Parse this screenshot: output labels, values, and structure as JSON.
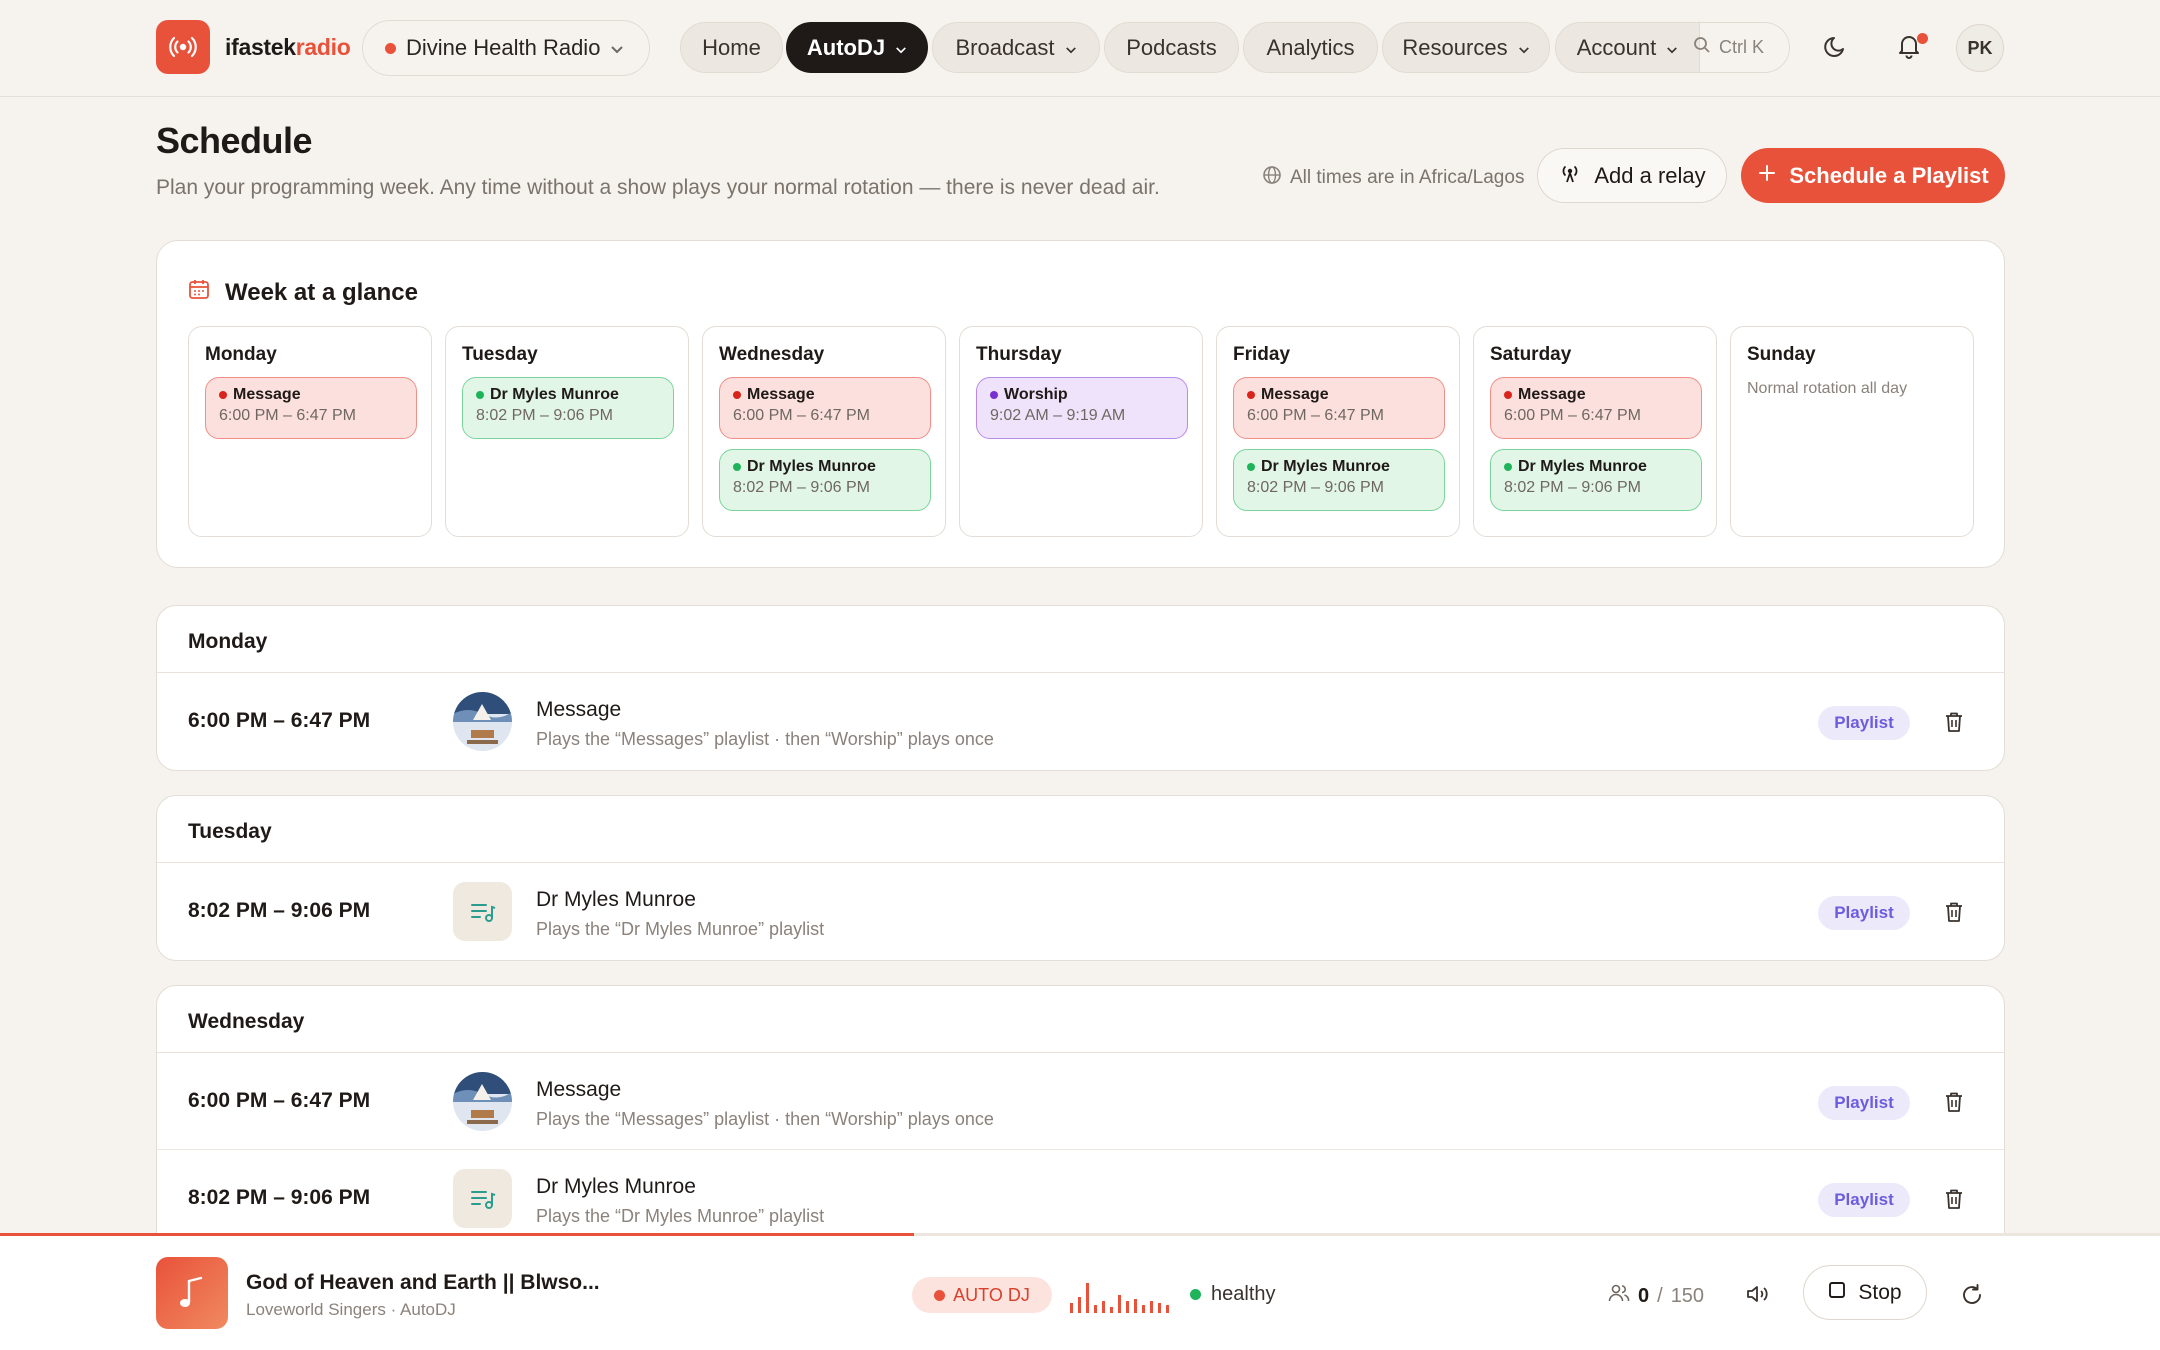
{
  "brand": {
    "name_plain": "ifastek",
    "name_accent": "radio",
    "accent": "#e9523a"
  },
  "station": {
    "name": "Divine Health Radio"
  },
  "nav": {
    "items": [
      {
        "label": "Home"
      },
      {
        "label": "AutoDJ",
        "active": true
      },
      {
        "label": "Broadcast"
      },
      {
        "label": "Podcasts"
      },
      {
        "label": "Analytics"
      },
      {
        "label": "Resources"
      },
      {
        "label": "Account"
      }
    ],
    "search_shortcut": "Ctrl K",
    "user_initials": "PK"
  },
  "header": {
    "title": "Schedule",
    "subtitle": "Plan your programming week. Any time without a show plays your normal rotation — there is never dead air.",
    "timezone": "All times are in Africa/Lagos",
    "add_relay": "Add a relay",
    "schedule_playlist": "Schedule a Playlist"
  },
  "week": {
    "title": "Week at a glance",
    "days": [
      {
        "name": "Monday",
        "shows": [
          {
            "title": "Message",
            "time": "6:00 PM – 6:47 PM",
            "color": "red"
          }
        ]
      },
      {
        "name": "Tuesday",
        "shows": [
          {
            "title": "Dr Myles Munroe",
            "time": "8:02 PM – 9:06 PM",
            "color": "green"
          }
        ]
      },
      {
        "name": "Wednesday",
        "shows": [
          {
            "title": "Message",
            "time": "6:00 PM – 6:47 PM",
            "color": "red"
          },
          {
            "title": "Dr Myles Munroe",
            "time": "8:02 PM – 9:06 PM",
            "color": "green"
          }
        ]
      },
      {
        "name": "Thursday",
        "shows": [
          {
            "title": "Worship",
            "time": "9:02 AM – 9:19 AM",
            "color": "purple"
          }
        ]
      },
      {
        "name": "Friday",
        "shows": [
          {
            "title": "Message",
            "time": "6:00 PM – 6:47 PM",
            "color": "red"
          },
          {
            "title": "Dr Myles Munroe",
            "time": "8:02 PM – 9:06 PM",
            "color": "green"
          }
        ]
      },
      {
        "name": "Saturday",
        "shows": [
          {
            "title": "Message",
            "time": "6:00 PM – 6:47 PM",
            "color": "red"
          },
          {
            "title": "Dr Myles Munroe",
            "time": "8:02 PM – 9:06 PM",
            "color": "green"
          }
        ]
      },
      {
        "name": "Sunday",
        "shows": [],
        "empty_text": "Normal rotation all day"
      }
    ]
  },
  "sections": [
    {
      "day": "Monday",
      "rows": [
        {
          "time": "6:00 PM – 6:47 PM",
          "title": "Message",
          "sub": "Plays the “Messages” playlist · then “Worship” plays once",
          "badge": "Playlist",
          "thumb": "cover"
        }
      ]
    },
    {
      "day": "Tuesday",
      "rows": [
        {
          "time": "8:02 PM – 9:06 PM",
          "title": "Dr Myles Munroe",
          "sub": "Plays the “Dr Myles Munroe” playlist",
          "badge": "Playlist",
          "thumb": "playlist-icon"
        }
      ]
    },
    {
      "day": "Wednesday",
      "rows": [
        {
          "time": "6:00 PM – 6:47 PM",
          "title": "Message",
          "sub": "Plays the “Messages” playlist · then “Worship” plays once",
          "badge": "Playlist",
          "thumb": "cover"
        },
        {
          "time": "8:02 PM – 9:06 PM",
          "title": "Dr Myles Munroe",
          "sub": "Plays the “Dr Myles Munroe” playlist",
          "badge": "Playlist",
          "thumb": "playlist-icon"
        }
      ]
    }
  ],
  "player": {
    "title": "God of Heaven and Earth || Blwso...",
    "artist": "Loveworld Singers",
    "source": "AutoDJ",
    "mode": "AUTO DJ",
    "health": "healthy",
    "listeners": "0",
    "capacity": "150",
    "stop": "Stop",
    "progress": 0.423
  }
}
